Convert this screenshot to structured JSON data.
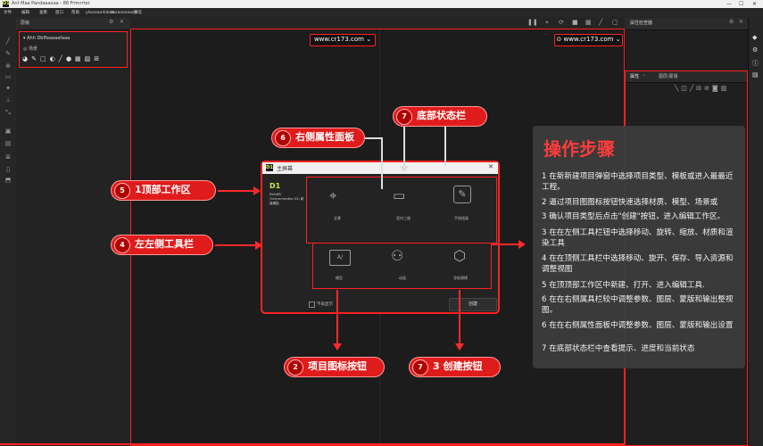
{
  "window": {
    "title": "Ant Maa Pandaaaoaa - 88 Frimrrter",
    "app_icon": "D1",
    "controls": [
      "—",
      "☐",
      "✕"
    ]
  },
  "menu": [
    "文件",
    "编辑",
    "查看",
    "窗口",
    "帮助",
    "ytoaaaodabab",
    "sosaaaoaaaa",
    "预览"
  ],
  "left_panel": {
    "header": "层级",
    "item1": "Ahh Dbffaaaaafaaa",
    "item2": "场景"
  },
  "url_left": "www.cr173.com",
  "url_right": "www.cr173.com",
  "right_panel": {
    "header": "属性检查器",
    "tab1": "属性",
    "tab2": "图层/蒙版",
    "tab3": "面板图层"
  },
  "callouts": [
    {
      "num": "5",
      "text": "1顶部工作区"
    },
    {
      "num": "4",
      "text": "左左侧工具栏"
    },
    {
      "num": "6",
      "text": "右侧属性面板"
    },
    {
      "num": "7",
      "text": "底部状态栏"
    },
    {
      "num": "2",
      "text": "项目图标按钮"
    },
    {
      "num": "7",
      "text": "3 创建按钮"
    }
  ],
  "dialog": {
    "title": "主屏幕",
    "side_title": "D1",
    "side_text": "Refn8R (Sceyemecdeo S3) 新建模板",
    "close": "✕",
    "cards": [
      "全景",
      "室内三维",
      "手绘插画",
      "模型",
      "动画",
      "导航建模"
    ],
    "checkbox_label": "不再显示",
    "create_button": "创建"
  },
  "steps": {
    "title": "操作步骤",
    "items": [
      "1 在新新建项目弹窗中选择项目类型、模板或进入最最近工程。",
      "2 逼过项目图图标按钮快速选择材质、模型、场景或",
      "3 确认项目类型后点击\"创建\"按钮，进入编辑工作区。",
      "3 在在左侧工具栏钮中选择移动、旋转、缩放、材质和渲染工具",
      "4 在在顶侧工具栏中选择移动、旋开、保存、导入资源和调整视图",
      "5 在顶顶部工作区中新建、打开、进入编辑工具.",
      "6 在在右侧属具栏较中调整参数、图层、蒙版和输出整视图。",
      "6 在在右侧属性面板中调整参数、图层、蒙版和输出设置",
      "7 在底部状态栏中查看提示、进度和当前状态"
    ]
  },
  "colors": {
    "accent": "#ff2020",
    "pill": "#e01b1b",
    "panel": "#232323"
  }
}
